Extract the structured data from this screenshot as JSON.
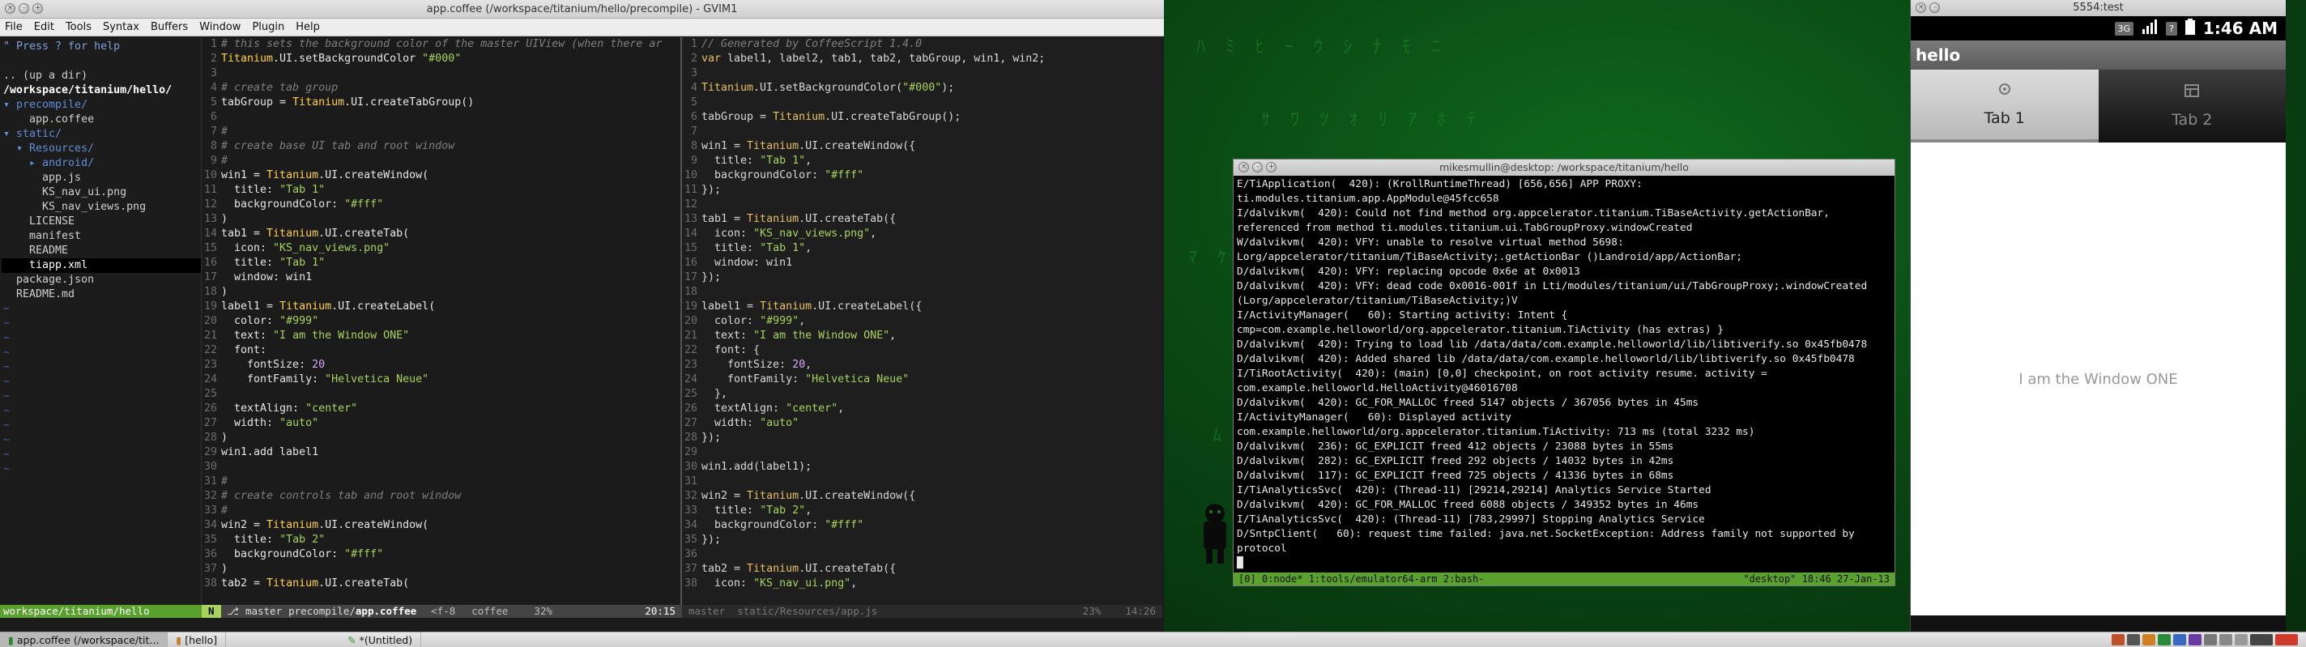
{
  "gvim": {
    "title": "app.coffee (/workspace/titanium/hello/precompile) - GVIM1",
    "menu": [
      "File",
      "Edit",
      "Tools",
      "Syntax",
      "Buffers",
      "Window",
      "Plugin",
      "Help"
    ],
    "tree": [
      "\" Press ? for help",
      "",
      ".. (up a dir)",
      "/workspace/titanium/hello/",
      "▾ precompile/",
      "    app.coffee",
      "▾ static/",
      "  ▾ Resources/",
      "    ▸ android/",
      "      app.js",
      "      KS_nav_ui.png",
      "      KS_nav_views.png",
      "    LICENSE",
      "    manifest",
      "    README",
      "    tiapp.xml",
      "  package.json",
      "  README.md"
    ],
    "left_code": [
      "# this sets the background color of the master UIView (when there ar",
      "Titanium.UI.setBackgroundColor \"#000\"",
      "",
      "# create tab group",
      "tabGroup = Titanium.UI.createTabGroup()",
      "",
      "#",
      "# create base UI tab and root window",
      "#",
      "win1 = Titanium.UI.createWindow(",
      "  title: \"Tab 1\"",
      "  backgroundColor: \"#fff\"",
      ")",
      "tab1 = Titanium.UI.createTab(",
      "  icon: \"KS_nav_views.png\"",
      "  title: \"Tab 1\"",
      "  window: win1",
      ")",
      "label1 = Titanium.UI.createLabel(",
      "  color: \"#999\"",
      "  text: \"I am the Window ONE\"",
      "  font:",
      "    fontSize: 20",
      "    fontFamily: \"Helvetica Neue\"",
      "",
      "  textAlign: \"center\"",
      "  width: \"auto\"",
      ")",
      "win1.add label1",
      "",
      "#",
      "# create controls tab and root window",
      "#",
      "win2 = Titanium.UI.createWindow(",
      "  title: \"Tab 2\"",
      "  backgroundColor: \"#fff\"",
      ")",
      "tab2 = Titanium.UI.createTab("
    ],
    "right_code": [
      "// Generated by CoffeeScript 1.4.0",
      "var label1, label2, tab1, tab2, tabGroup, win1, win2;",
      "",
      "Titanium.UI.setBackgroundColor(\"#000\");",
      "",
      "tabGroup = Titanium.UI.createTabGroup();",
      "",
      "win1 = Titanium.UI.createWindow({",
      "  title: \"Tab 1\",",
      "  backgroundColor: \"#fff\"",
      "});",
      "",
      "tab1 = Titanium.UI.createTab({",
      "  icon: \"KS_nav_views.png\",",
      "  title: \"Tab 1\",",
      "  window: win1",
      "});",
      "",
      "label1 = Titanium.UI.createLabel({",
      "  color: \"#999\",",
      "  text: \"I am the Window ONE\",",
      "  font: {",
      "    fontSize: 20,",
      "    fontFamily: \"Helvetica Neue\"",
      "  },",
      "  textAlign: \"center\",",
      "  width: \"auto\"",
      "});",
      "",
      "win1.add(label1);",
      "",
      "win2 = Titanium.UI.createWindow({",
      "  title: \"Tab 2\",",
      "  backgroundColor: \"#fff\"",
      "});",
      "",
      "tab2 = Titanium.UI.createTab({",
      "  icon: \"KS_nav_ui.png\","
    ],
    "status": {
      "tree_path": "workspace/titanium/hello",
      "mode": "N",
      "branch": "master",
      "file_dir": "precompile/",
      "file_name": "app.coffee",
      "encoding": "<f-8",
      "filetype": "coffee",
      "percent": "32%",
      "position": "20:15",
      "right_branch": "master",
      "right_file": "static/Resources/app.js",
      "right_percent": "23%",
      "right_position": "14:26"
    }
  },
  "terminal": {
    "title": "mikesmullin@desktop: /workspace/titanium/hello",
    "lines": [
      "E/TiApplication(  420): (KrollRuntimeThread) [656,656] APP PROXY: ti.modules.titanium.app.AppModule@45fcc658",
      "I/dalvikvm(  420): Could not find method org.appcelerator.titanium.TiBaseActivity.getActionBar, referenced from method ti.modules.titanium.ui.TabGroupProxy.windowCreated",
      "W/dalvikvm(  420): VFY: unable to resolve virtual method 5698: Lorg/appcelerator/titanium/TiBaseActivity;.getActionBar ()Landroid/app/ActionBar;",
      "D/dalvikvm(  420): VFY: replacing opcode 0x6e at 0x0013",
      "D/dalvikvm(  420): VFY: dead code 0x0016-001f in Lti/modules/titanium/ui/TabGroupProxy;.windowCreated (Lorg/appcelerator/titanium/TiBaseActivity;)V",
      "I/ActivityManager(   60): Starting activity: Intent { cmp=com.example.helloworld/org.appcelerator.titanium.TiActivity (has extras) }",
      "D/dalvikvm(  420): Trying to load lib /data/data/com.example.helloworld/lib/libtiverify.so 0x45fb0478",
      "D/dalvikvm(  420): Added shared lib /data/data/com.example.helloworld/lib/libtiverify.so 0x45fb0478",
      "I/TiRootActivity(  420): (main) [0,0] checkpoint, on root activity resume. activity = com.example.helloworld.HelloActivity@46016708",
      "D/dalvikvm(  420): GC_FOR_MALLOC freed 5147 objects / 367056 bytes in 45ms",
      "I/ActivityManager(   60): Displayed activity com.example.helloworld/org.appcelerator.titanium.TiActivity: 713 ms (total 3232 ms)",
      "D/dalvikvm(  236): GC_EXPLICIT freed 412 objects / 23088 bytes in 55ms",
      "D/dalvikvm(  282): GC_EXPLICIT freed 292 objects / 14032 bytes in 42ms",
      "D/dalvikvm(  117): GC_EXPLICIT freed 725 objects / 41336 bytes in 68ms",
      "I/TiAnalyticsSvc(  420): (Thread-11) [29214,29214] Analytics Service Started",
      "D/dalvikvm(  420): GC_FOR_MALLOC freed 6088 objects / 349352 bytes in 46ms",
      "I/TiAnalyticsSvc(  420): (Thread-11) [783,29997] Stopping Analytics Service",
      "D/SntpClient(   60): request time failed: java.net.SocketException: Address family not supported by protocol",
      "█"
    ],
    "tmux_left": "[0] 0:node* 1:tools/emulator64-arm  2:bash-",
    "tmux_right": "\"desktop\" 18:46 27-Jan-13"
  },
  "emulator": {
    "title": "5554:test",
    "net_badge": "3G",
    "time": "1:46 AM",
    "app_title": "hello",
    "tabs": [
      "Tab 1",
      "Tab 2"
    ],
    "body_text": "I am the Window ONE"
  },
  "taskbar": {
    "items": [
      "app.coffee (/workspace/tit...",
      "[hello]",
      "*(Untitled)"
    ]
  }
}
